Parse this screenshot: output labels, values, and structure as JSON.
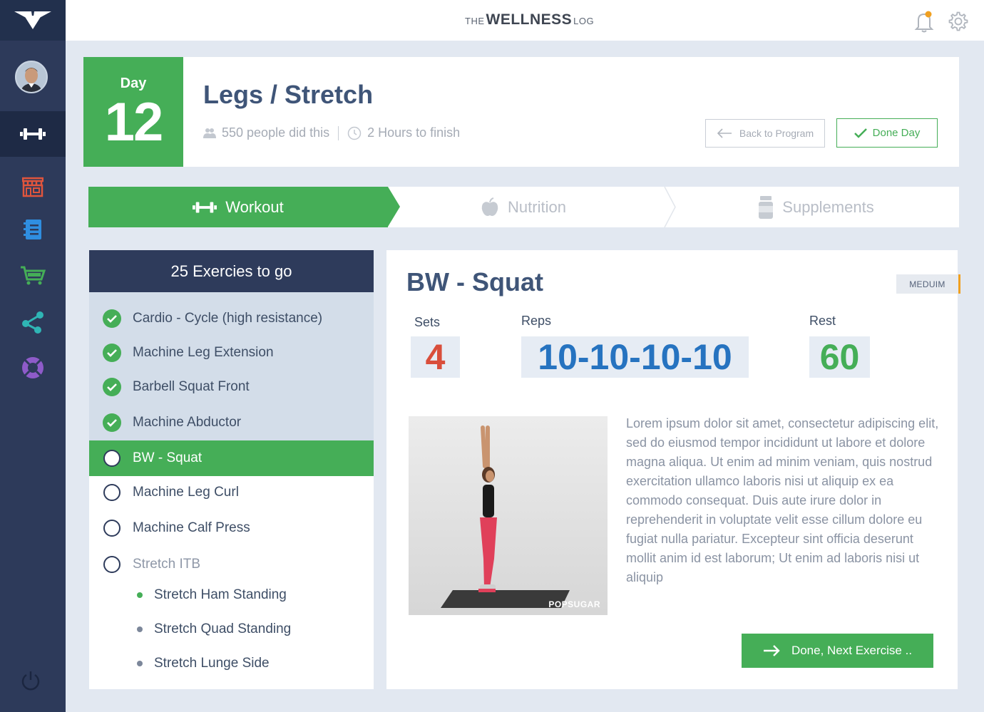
{
  "colors": {
    "sidebar": "#2d3a5a",
    "sidebar_active": "#1e2a45",
    "accent_green": "#45ae57",
    "heading_blue": "#3f5578",
    "sets_red": "#d94e3b",
    "reps_blue": "#2673c0",
    "rest_green": "#45ae57",
    "badge_orange": "#f0a020"
  },
  "brand": {
    "prefix": "THE",
    "name": "WELLNESS",
    "suffix": "LOG"
  },
  "sidebar": {
    "items": [
      {
        "icon": "dumbbell-icon",
        "active": true
      },
      {
        "icon": "store-icon",
        "color": "#e0553d"
      },
      {
        "icon": "notebook-icon",
        "color": "#2f8ee0"
      },
      {
        "icon": "cart-icon",
        "color": "#45ae57"
      },
      {
        "icon": "share-icon",
        "color": "#2fb5b5"
      },
      {
        "icon": "lifebuoy-icon",
        "color": "#8e5bc9"
      }
    ],
    "bottom_icon": "power-icon"
  },
  "day": {
    "label": "Day",
    "number": "12",
    "title": "Legs / Stretch",
    "people": "550 people did this",
    "duration": "2 Hours to finish",
    "back_button": "Back to Program",
    "done_button": "Done Day"
  },
  "tabs": [
    {
      "label": "Workout",
      "icon": "dumbbell-icon",
      "active": true
    },
    {
      "label": "Nutrition",
      "icon": "apple-icon",
      "active": false
    },
    {
      "label": "Supplements",
      "icon": "bottle-icon",
      "active": false
    }
  ],
  "exercise_list": {
    "header": "25 Exercies to go",
    "items": [
      {
        "label": "Cardio - Cycle (high resistance)",
        "status": "done"
      },
      {
        "label": "Machine Leg Extension",
        "status": "done"
      },
      {
        "label": "Barbell Squat Front",
        "status": "done"
      },
      {
        "label": "Machine Abductor",
        "status": "done"
      },
      {
        "label": "BW - Squat",
        "status": "current"
      },
      {
        "label": "Machine Leg Curl",
        "status": "todo"
      },
      {
        "label": "Machine Calf Press",
        "status": "todo"
      },
      {
        "label": "Stretch ITB",
        "status": "muted"
      }
    ],
    "subitems": [
      {
        "label": "Stretch Ham Standing",
        "dot": "#45ae57"
      },
      {
        "label": "Stretch Quad Standing",
        "dot": "#7c879a"
      },
      {
        "label": "Stretch Lunge Side",
        "dot": "#7c879a"
      }
    ]
  },
  "detail": {
    "title": "BW - Squat",
    "difficulty": "MEDUIM",
    "sets_label": "Sets",
    "sets_value": "4",
    "reps_label": "Reps",
    "reps_value": "10-10-10-10",
    "rest_label": "Rest",
    "rest_value": "60",
    "photo_watermark": "POPSUGAR",
    "description": "Lorem ipsum dolor sit amet, consectetur adipiscing elit, sed do eiusmod tempor incididunt ut labore et dolore magna aliqua. Ut enim ad minim veniam, quis nostrud exercitation ullamco laboris nisi ut aliquip ex ea commodo consequat. Duis aute irure dolor in reprehenderit in voluptate velit esse cillum dolore eu fugiat nulla pariatur. Excepteur sint officia deserunt mollit anim id est laborum; Ut enim ad laboris nisi ut aliquip",
    "next_button": "Done, Next Exercise .."
  }
}
